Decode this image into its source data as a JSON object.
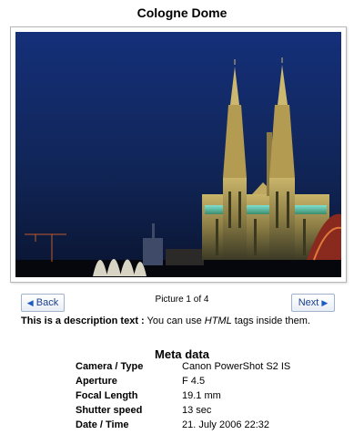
{
  "title": "Cologne Dome",
  "navigation": {
    "back_label": "Back",
    "next_label": "Next",
    "counter": "Picture 1 of 4"
  },
  "description": {
    "bold": "This is a description text :",
    "text_before": " You can use ",
    "emphasis": "HTML",
    "text_after": " tags inside them."
  },
  "meta": {
    "title": "Meta data",
    "rows": [
      {
        "key": "Camera / Type",
        "value": "Canon PowerShot S2 IS"
      },
      {
        "key": "Aperture",
        "value": "F 4.5"
      },
      {
        "key": "Focal Length",
        "value": "19.1 mm"
      },
      {
        "key": "Shutter speed",
        "value": "13 sec"
      },
      {
        "key": "Date / Time",
        "value": "21. July 2006 22:32"
      }
    ]
  },
  "icons": {
    "back": "triangle-left-icon",
    "next": "triangle-right-icon"
  },
  "colors": {
    "sky_top": "#142f6e",
    "sky_bottom": "#0b1738",
    "accent": "#1f5bc4"
  }
}
